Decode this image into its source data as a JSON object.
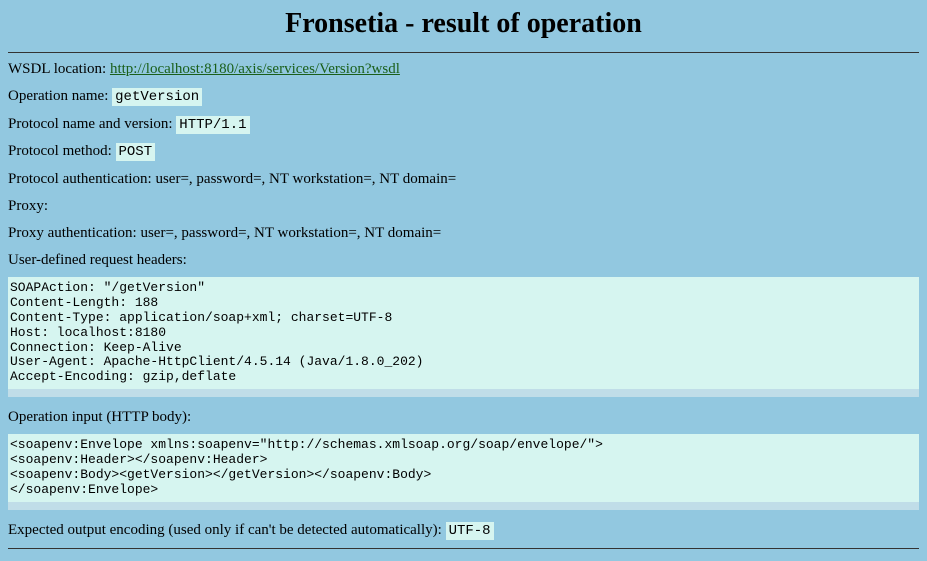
{
  "title": "Fronsetia - result of operation",
  "fields": {
    "wsdl_location_label": "WSDL location: ",
    "wsdl_location_url": "http://localhost:8180/axis/services/Version?wsdl",
    "operation_name_label": "Operation name: ",
    "operation_name_value": "getVersion",
    "protocol_version_label": "Protocol name and version: ",
    "protocol_version_value": "HTTP/1.1",
    "protocol_method_label": "Protocol method: ",
    "protocol_method_value": "POST",
    "protocol_auth_label": "Protocol authentication: user=, password=, NT workstation=, NT domain=",
    "proxy_label": "Proxy:",
    "proxy_auth_label": "Proxy authentication: user=, password=, NT workstation=, NT domain=",
    "user_headers_label": "User-defined request headers:",
    "headers_block": "SOAPAction: \"/getVersion\"\nContent-Length: 188\nContent-Type: application/soap+xml; charset=UTF-8\nHost: localhost:8180\nConnection: Keep-Alive\nUser-Agent: Apache-HttpClient/4.5.14 (Java/1.8.0_202)\nAccept-Encoding: gzip,deflate",
    "operation_input_label": "Operation input (HTTP body):",
    "body_block": "<soapenv:Envelope xmlns:soapenv=\"http://schemas.xmlsoap.org/soap/envelope/\">\n<soapenv:Header></soapenv:Header>\n<soapenv:Body><getVersion></getVersion></soapenv:Body>\n</soapenv:Envelope>",
    "expected_encoding_label": "Expected output encoding (used only if can't be detected automatically): ",
    "expected_encoding_value": "UTF-8"
  }
}
